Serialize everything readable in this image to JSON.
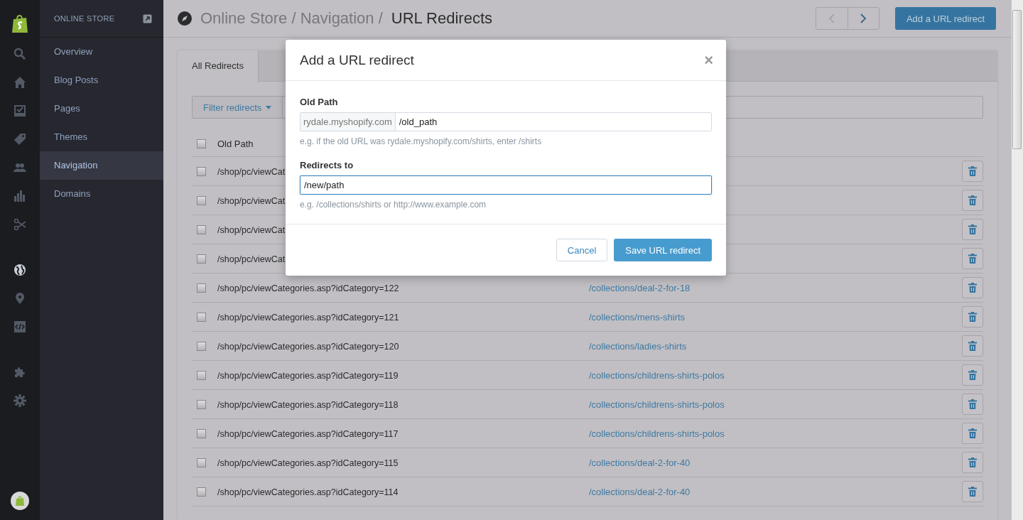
{
  "sidebar": {
    "heading": "ONLINE STORE",
    "items": [
      {
        "label": "Overview",
        "selected": false
      },
      {
        "label": "Blog Posts",
        "selected": false
      },
      {
        "label": "Pages",
        "selected": false
      },
      {
        "label": "Themes",
        "selected": false
      },
      {
        "label": "Navigation",
        "selected": true
      },
      {
        "label": "Domains",
        "selected": false
      }
    ]
  },
  "header": {
    "breadcrumb": "Online Store / Navigation /",
    "current": "URL Redirects",
    "add_button": "Add a URL redirect"
  },
  "tabs": [
    {
      "label": "All Redirects",
      "selected": true
    }
  ],
  "filter": {
    "label": "Filter redirects"
  },
  "table": {
    "columns": [
      "Old Path"
    ],
    "header_checked": false,
    "rows": [
      {
        "old_path": "/shop/pc/viewCat",
        "redirect": "",
        "checked": false
      },
      {
        "old_path": "/shop/pc/viewCat",
        "redirect": "",
        "checked": false
      },
      {
        "old_path": "/shop/pc/viewCat",
        "redirect": "",
        "checked": false
      },
      {
        "old_path": "/shop/pc/viewCat",
        "redirect": "",
        "checked": false
      },
      {
        "old_path": "/shop/pc/viewCategories.asp?idCategory=122",
        "redirect": "/collections/deal-2-for-18",
        "checked": false
      },
      {
        "old_path": "/shop/pc/viewCategories.asp?idCategory=121",
        "redirect": "/collections/mens-shirts",
        "checked": false
      },
      {
        "old_path": "/shop/pc/viewCategories.asp?idCategory=120",
        "redirect": "/collections/ladies-shirts",
        "checked": false
      },
      {
        "old_path": "/shop/pc/viewCategories.asp?idCategory=119",
        "redirect": "/collections/childrens-shirts-polos",
        "checked": false
      },
      {
        "old_path": "/shop/pc/viewCategories.asp?idCategory=118",
        "redirect": "/collections/childrens-shirts-polos",
        "checked": false
      },
      {
        "old_path": "/shop/pc/viewCategories.asp?idCategory=117",
        "redirect": "/collections/childrens-shirts-polos",
        "checked": false
      },
      {
        "old_path": "/shop/pc/viewCategories.asp?idCategory=115",
        "redirect": "/collections/deal-2-for-40",
        "checked": false
      },
      {
        "old_path": "/shop/pc/viewCategories.asp?idCategory=114",
        "redirect": "/collections/deal-2-for-40",
        "checked": false
      }
    ]
  },
  "modal": {
    "title": "Add a URL redirect",
    "close": "×",
    "old_path": {
      "label": "Old Path",
      "prefix": "rydale.myshopify.com",
      "value": "/old_path",
      "hint": "e.g. if the old URL was rydale.myshopify.com/shirts, enter /shirts"
    },
    "redirects_to": {
      "label": "Redirects to",
      "value": "/new/path",
      "hint": "e.g. /collections/shirts or http://www.example.com",
      "focused": true
    },
    "cancel": "Cancel",
    "save": "Save URL redirect"
  }
}
